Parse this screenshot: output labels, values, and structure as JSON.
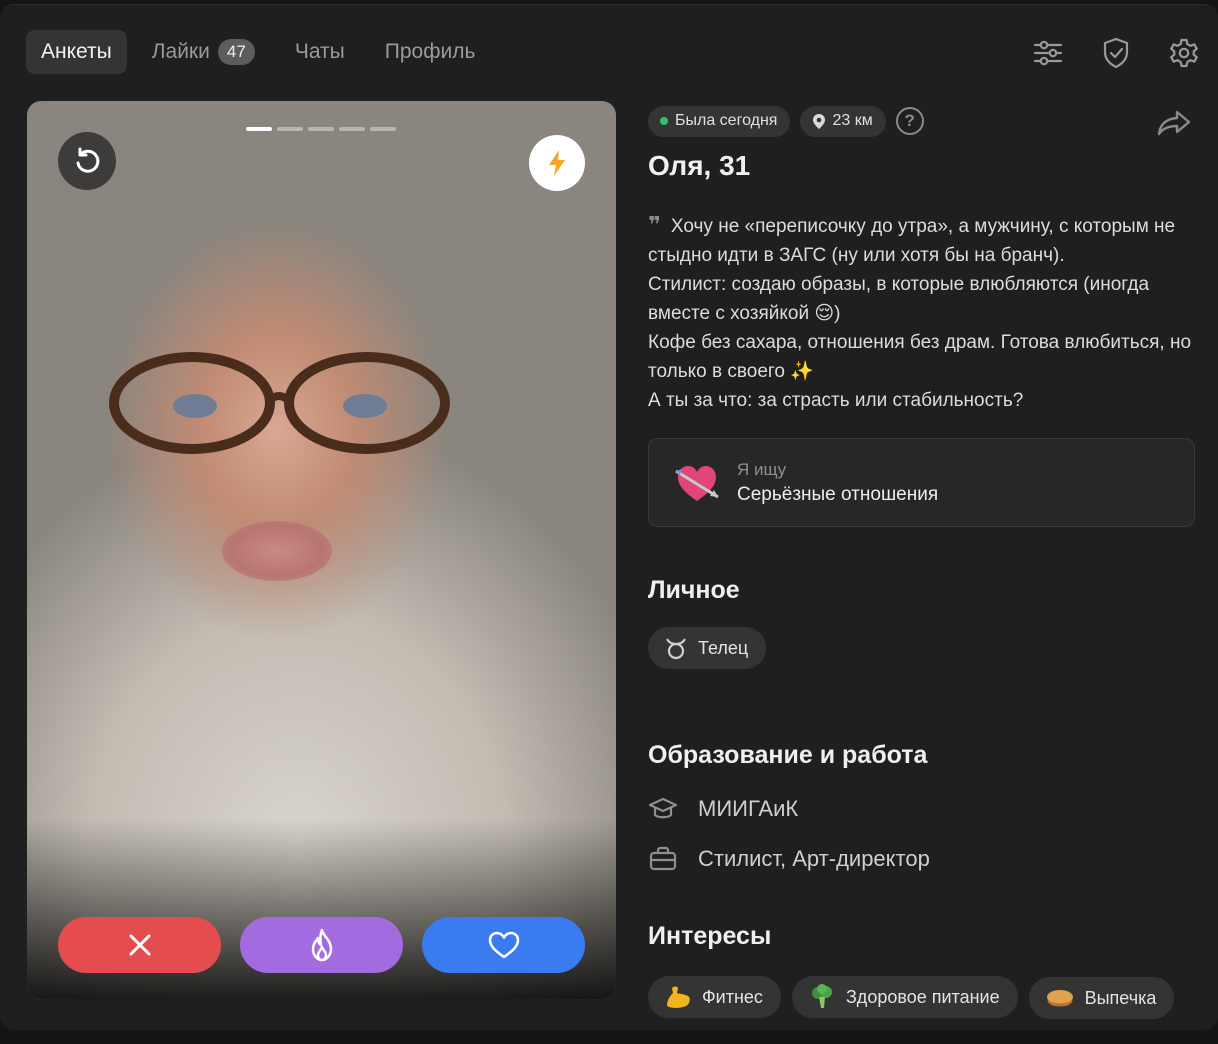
{
  "nav": {
    "tabs": [
      {
        "label": "Анкеты",
        "active": true
      },
      {
        "label": "Лайки",
        "badge": "47"
      },
      {
        "label": "Чаты"
      },
      {
        "label": "Профиль"
      }
    ],
    "icons": [
      "filters-icon",
      "shield-check-icon",
      "gear-icon"
    ]
  },
  "photo": {
    "slides_total": 5,
    "slide_current": 1,
    "actions": [
      "close-icon",
      "flame-icon",
      "heart-icon"
    ],
    "colors": {
      "dislike": "#e54c4f",
      "superlike": "#a26be0",
      "like": "#3a7cf0"
    }
  },
  "profile": {
    "status": "Была сегодня",
    "distance": "23 км",
    "help": "?",
    "name_age": "Оля, 31",
    "bio": [
      "Хочу не «переписочку до утра», а мужчину, с которым не стыдно идти в ЗАГС (ну или хотя бы на бранч).",
      "Стилист: создаю образы, в которые влюбляются (иногда вместе с хозяйкой 😌)",
      "Кофе без сахара, отношения без драм. Готова влюбиться, но только в своего ✨",
      "А ты за что: за страсть или стабильность?"
    ],
    "looking_for": {
      "label": "Я ищу",
      "value": "Серьёзные отношения",
      "emoji": "💘"
    }
  },
  "personal": {
    "title": "Личное",
    "tags": [
      {
        "label": "Телец",
        "icon": "taurus-icon"
      }
    ]
  },
  "education_work": {
    "title": "Образование и работа",
    "education": "МИИГАиК",
    "job": "Стилист, Арт-директор"
  },
  "interests": {
    "title": "Интересы",
    "tags": [
      {
        "label": "Фитнес",
        "emoji": "💪"
      },
      {
        "label": "Здоровое питание",
        "emoji": "🥦"
      },
      {
        "label": "Выпечка",
        "emoji": "🥧"
      }
    ]
  }
}
